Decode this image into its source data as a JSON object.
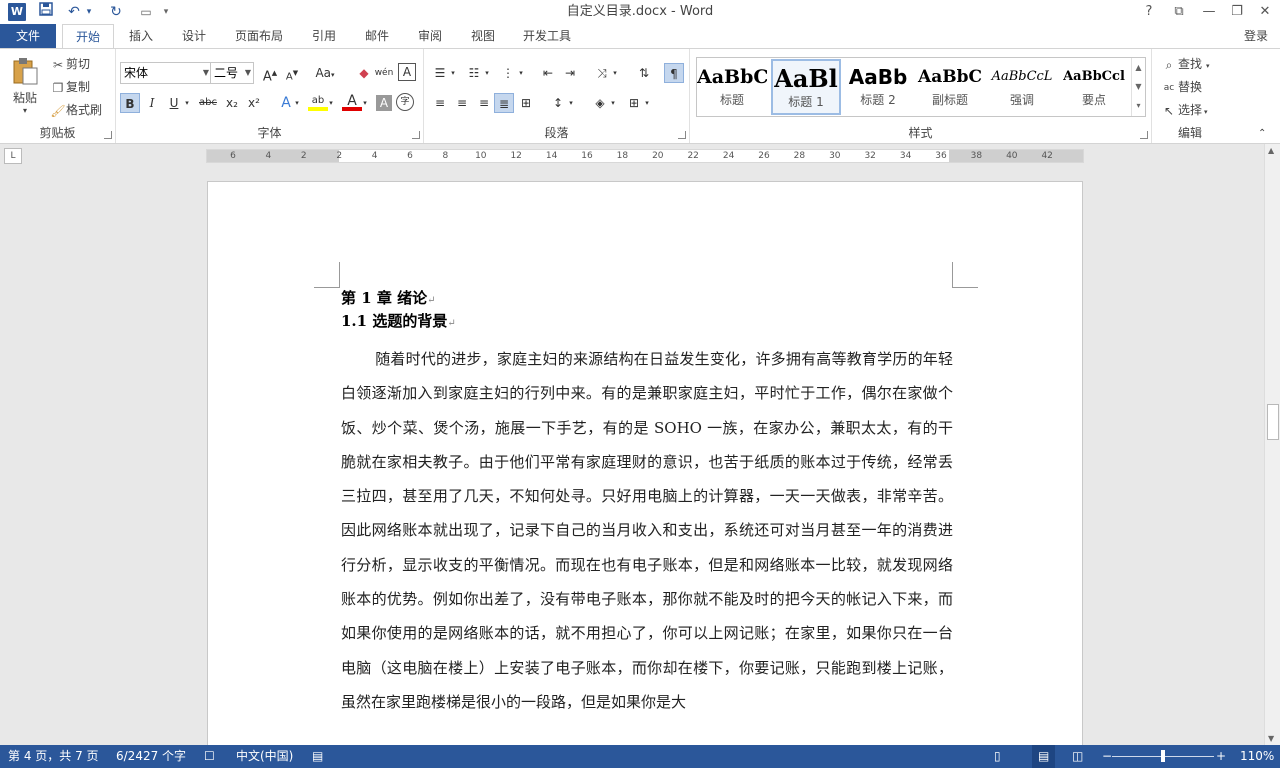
{
  "title_bar": {
    "app_icon_letter": "W",
    "doc_title": "自定义目录.docx - Word",
    "help": "?",
    "restore_ribbon": "⧉",
    "minimize": "—",
    "maximize": "❐",
    "close": "✕",
    "qat_dropdown": "▾"
  },
  "tabs": {
    "file": "文件",
    "home": "开始",
    "insert": "插入",
    "design": "设计",
    "layout": "页面布局",
    "references": "引用",
    "mailings": "邮件",
    "review": "审阅",
    "view": "视图",
    "developer": "开发工具",
    "login": "登录"
  },
  "clipboard": {
    "paste": "粘贴",
    "cut": "剪切",
    "copy": "复制",
    "format_painter": "格式刷",
    "group_label": "剪贴板"
  },
  "font": {
    "name": "宋体",
    "size": "二号",
    "grow": "A",
    "shrink": "A",
    "case": "Aa",
    "phonetic": "wén",
    "border_char": "A",
    "bold": "B",
    "italic": "I",
    "underline": "U",
    "strike": "abc",
    "subscript": "x₂",
    "superscript": "x²",
    "text_effect": "A",
    "highlight": "ab",
    "font_color": "A",
    "char_shading": "A",
    "enclose": "字",
    "group_label": "字体"
  },
  "paragraph": {
    "group_label": "段落"
  },
  "styles": {
    "items": [
      {
        "sample": "AaBbC",
        "name": "标题"
      },
      {
        "sample": "AaBl",
        "name": "标题 1"
      },
      {
        "sample": "AaBb",
        "name": "标题 2"
      },
      {
        "sample": "AaBbC",
        "name": "副标题"
      },
      {
        "sample": "AaBbCcL",
        "name": "强调"
      },
      {
        "sample": "AaBbCcl",
        "name": "要点"
      }
    ],
    "group_label": "样式"
  },
  "editing": {
    "find": "查找",
    "replace": "替换",
    "select": "选择",
    "group_label": "编辑"
  },
  "ruler": {
    "tab_selector": "L",
    "numbers": [
      "6",
      "4",
      "2",
      "2",
      "4",
      "6",
      "8",
      "10",
      "12",
      "14",
      "16",
      "18",
      "20",
      "22",
      "24",
      "26",
      "28",
      "30",
      "32",
      "34",
      "36",
      "38",
      "40",
      "42"
    ]
  },
  "document": {
    "heading1": "第 1 章 绪论",
    "heading2": "1.1 选题的背景",
    "paragraph_mark": "↵",
    "body": "随着时代的进步，家庭主妇的来源结构在日益发生变化，许多拥有高等教育学历的年轻白领逐渐加入到家庭主妇的行列中来。有的是兼职家庭主妇，平时忙于工作，偶尔在家做个饭、炒个菜、煲个汤，施展一下手艺，有的是 SOHO 一族，在家办公，兼职太太，有的干脆就在家相夫教子。由于他们平常有家庭理财的意识，也苦于纸质的账本过于传统，经常丢三拉四，甚至用了几天，不知何处寻。只好用电脑上的计算器，一天一天做表，非常辛苦。因此网络账本就出现了，记录下自己的当月收入和支出，系统还可对当月甚至一年的消费进行分析，显示收支的平衡情况。而现在也有电子账本，但是和网络账本一比较，就发现网络账本的优势。例如你出差了，没有带电子账本，那你就不能及时的把今天的帐记入下来，而如果你使用的是网络账本的话，就不用担心了，你可以上网记账；在家里，如果你只在一台电脑（这电脑在楼上）上安装了电子账本，而你却在楼下，你要记账，只能跑到楼上记账，虽然在家里跑楼梯是很小的一段路，但是如果你是大"
  },
  "status": {
    "page": "第 4 页，共 7 页",
    "words": "6/2427 个字",
    "language": "中文(中国)",
    "zoom_minus": "−",
    "zoom_plus": "+",
    "zoom": "110%"
  },
  "colors": {
    "accent": "#2b579a",
    "highlight": "#ffff00",
    "font_color": "#e00000"
  }
}
